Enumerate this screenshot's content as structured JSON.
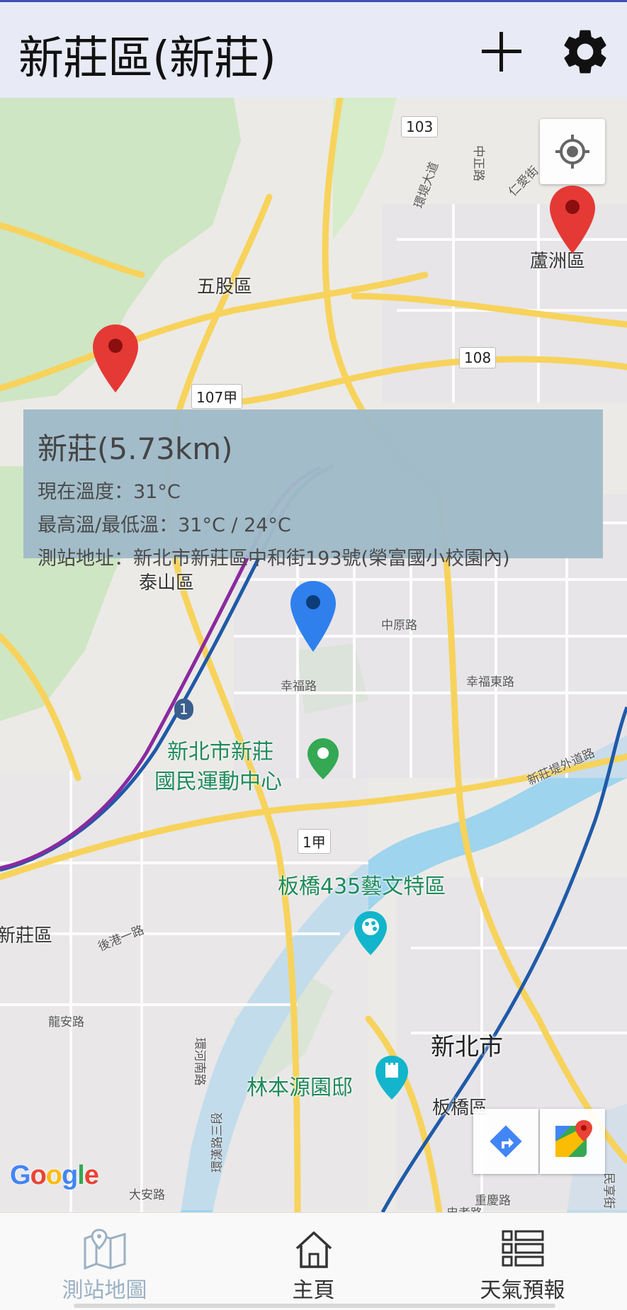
{
  "header": {
    "title": "新莊區(新莊)",
    "add_icon": "plus-icon",
    "settings_icon": "gear-icon",
    "background": "#e8eaf6"
  },
  "map": {
    "district_labels": [
      "五股區",
      "蘆洲區",
      "新莊區",
      "板橋區",
      "泰山區"
    ],
    "city_label": "新北市",
    "poi_labels": [
      "新北市新莊",
      "國民運動中心",
      "板橋435藝文特區",
      "林本源園邸"
    ],
    "road_labels": [
      "中原路",
      "幸福路",
      "幸福東路",
      "新莊堤外道路",
      "後港一路",
      "龍安路",
      "大安路",
      "環堤大道",
      "中正路",
      "仁愛街",
      "環河南路",
      "環漢路三段",
      "重慶路",
      "忠孝路",
      "民享街"
    ],
    "road_shields": [
      "103",
      "108",
      "107甲",
      "1",
      "1甲"
    ],
    "google_logo": "Google",
    "my_location_icon": "crosshair-icon",
    "directions_icon": "directions-icon",
    "google_maps_icon": "google-maps-icon"
  },
  "info_window": {
    "title": "新莊(5.73km)",
    "current_temp": "現在溫度：31°C",
    "high_low": "最高溫/最低溫：31°C / 24°C",
    "address": "測站地址：新北市新莊區中和街193號(榮富國小校園內)"
  },
  "markers": [
    {
      "name": "station-marker-luzhou",
      "color": "#e53935"
    },
    {
      "name": "station-marker-taishan",
      "color": "#e53935"
    },
    {
      "name": "station-marker-xinzhuang-selected",
      "color": "#2f80ed"
    }
  ],
  "bottom_nav": {
    "tabs": [
      {
        "label": "測站地圖",
        "icon": "map-pin-icon",
        "active": true
      },
      {
        "label": "主頁",
        "icon": "home-icon",
        "active": false
      },
      {
        "label": "天氣預報",
        "icon": "list-icon",
        "active": false
      }
    ],
    "active_color": "#9bb1c4"
  }
}
